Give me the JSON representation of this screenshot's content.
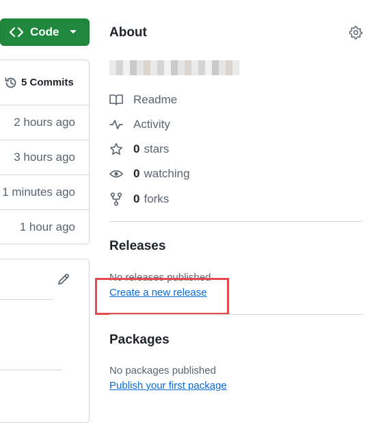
{
  "code_button": {
    "label": "Code"
  },
  "commits": {
    "label": "5 Commits",
    "times": [
      "2 hours ago",
      "3 hours ago",
      "1 minutes ago",
      "1 hour ago"
    ]
  },
  "about": {
    "title": "About",
    "items": {
      "readme": "Readme",
      "activity": "Activity",
      "stars_count": "0",
      "stars_label": "stars",
      "watching_count": "0",
      "watching_label": "watching",
      "forks_count": "0",
      "forks_label": "forks"
    }
  },
  "releases": {
    "title": "Releases",
    "empty_text": "No releases published",
    "create_link": "Create a new release"
  },
  "packages": {
    "title": "Packages",
    "empty_text": "No packages published",
    "publish_link": "Publish your first package"
  },
  "colors": {
    "code_button_bg": "#1f883d",
    "link": "#0969da",
    "highlight_border": "#e5484d"
  }
}
